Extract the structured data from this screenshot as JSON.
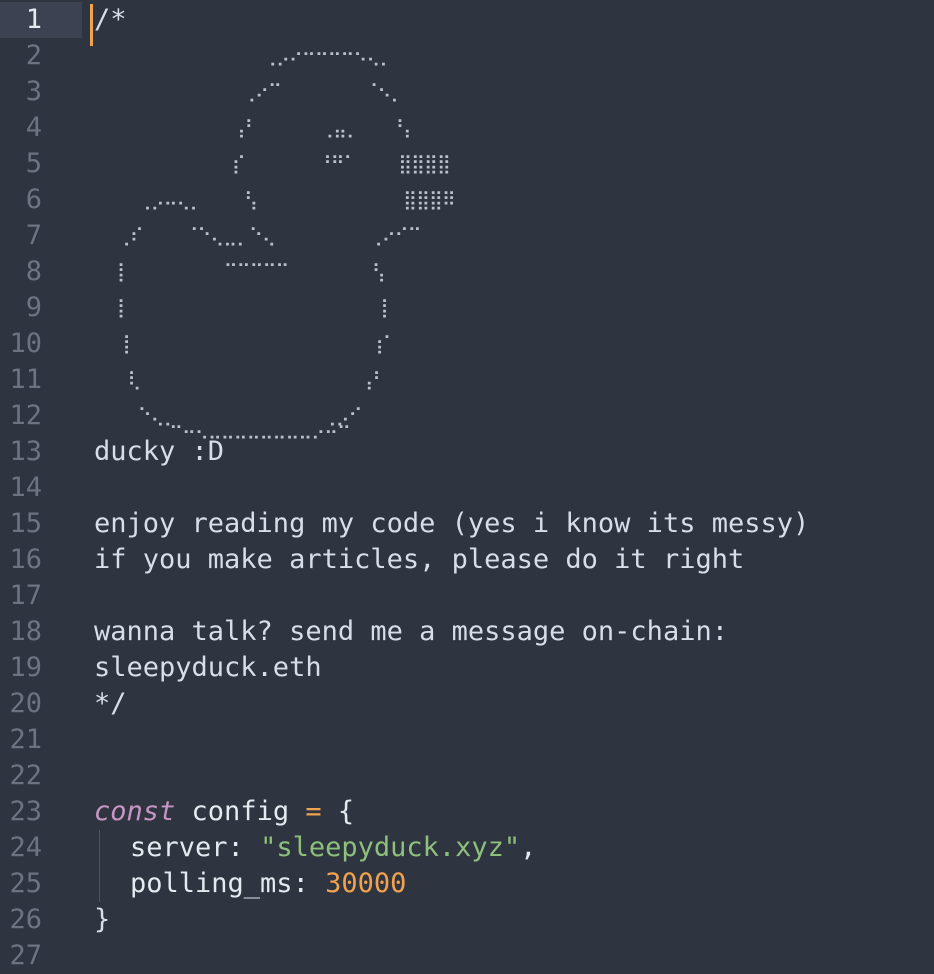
{
  "editor": {
    "active_line": "1",
    "line_numbers": [
      "1",
      "2",
      "3",
      "4",
      "5",
      "6",
      "7",
      "8",
      "9",
      "10",
      "11",
      "12",
      "13",
      "14",
      "15",
      "16",
      "17",
      "18",
      "19",
      "20",
      "21",
      "22",
      "23",
      "24",
      "25",
      "26",
      "27"
    ],
    "comment_open": "/*",
    "ascii_art": [
      "                ⢀⡠⠔⠒⠒⠒⠒⠢⢄⡀",
      "              ⢀⠔⠉        ⠈⠢⡀",
      "             ⢠⠃      ⢀⣤⡀   ⠘⡄",
      "             ⡎       ⠘⠛⠁    ⣿⣿⣿⣿",
      "    ⢀⡠⠤⢄⡀    ⢣              ⣿⣿⣿⠿",
      "  ⢀⠎    ⠈⠑⢄⣀⡀⠑⢄         ⢀⠔⠊⠉",
      "  ⡇         ⠉⠉⠉⠉⠉        ⢣",
      "  ⡇                        ⡇",
      "  ⢸                       ⢰⠁",
      "   ⢇                     ⢠⠃",
      "    ⠑⢄⡀              ⢀⡠⠊",
      "       ⠉⠒⠢⠤⠤⠤⠤⠤⠤⠤⠤⠔⠒⠉"
    ],
    "comment_lines": {
      "l13": "ducky :D",
      "l15": "enjoy reading my code (yes i know its messy)",
      "l16": "if you make articles, please do it right",
      "l18": "wanna talk? send me a message on-chain:",
      "l19": "sleepyduck.eth",
      "l20": "*/"
    },
    "code": {
      "keyword_const": "const",
      "var_name": "config",
      "assign": "=",
      "open_brace": "{",
      "server_key": "server",
      "colon": ":",
      "server_value": "\"sleepyduck.xyz\"",
      "comma": ",",
      "polling_key": "polling_ms",
      "polling_value": "30000",
      "close_brace": "}"
    }
  },
  "colors": {
    "background": "#2e3440",
    "keyword": "#c895c4",
    "string": "#8ec07c",
    "number": "#f0a24e",
    "caret": "#f0a24e"
  }
}
